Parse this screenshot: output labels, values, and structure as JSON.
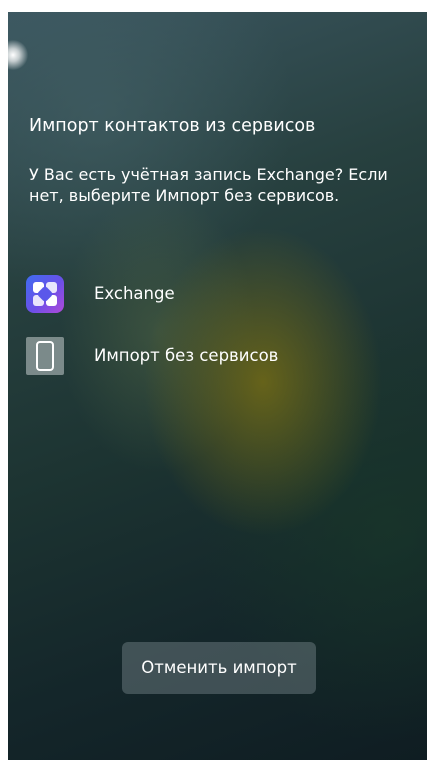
{
  "dialog": {
    "title": "Импорт контактов из сервисов",
    "message": "У Вас есть учётная запись Exchange? Если нет, выберите Импорт без сервисов."
  },
  "options": [
    {
      "label": "Exchange",
      "icon": "exchange-app-icon"
    },
    {
      "label": "Импорт без сервисов",
      "icon": "phone-device-icon"
    }
  ],
  "cancel_button": {
    "label": "Отменить импорт"
  }
}
